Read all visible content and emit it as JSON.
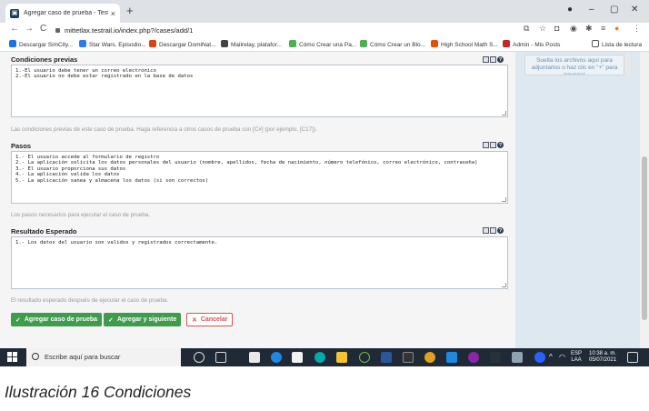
{
  "browser": {
    "tab_title": "Agregar caso de prueba - TestRail",
    "tab_close": "×",
    "new_tab": "+",
    "url": "mittetlax.testrail.io/index.php?/cases/add/1",
    "window_controls": {
      "minimize": "–",
      "maximize": "▢",
      "close": "✕"
    },
    "nav": {
      "back": "←",
      "forward": "→",
      "reload": "C"
    },
    "bookmarks": [
      {
        "label": "Descargar SimCity...",
        "color": "#1a73e8"
      },
      {
        "label": "Star Wars. Episodio...",
        "color": "#2b7de9"
      },
      {
        "label": "Descargar DomiNat...",
        "color": "#d84315"
      },
      {
        "label": "Mailrelay, platafor...",
        "color": "#444444"
      },
      {
        "label": "Cómo Crear una Pa...",
        "color": "#4caf50"
      },
      {
        "label": "Cómo Crear un Blo...",
        "color": "#4caf50"
      },
      {
        "label": "High School Math S...",
        "color": "#e65100"
      },
      {
        "label": "Admin - Mis Posts",
        "color": "#c62828"
      },
      {
        "label": "Lista de lectura",
        "color": "#555555"
      }
    ]
  },
  "attachments": {
    "dropzone_text": "Suelta los archivos aquí para adjuntarlos o haz clic en \"+\" para navegar"
  },
  "form": {
    "preconditions": {
      "label": "Condiciones previas",
      "value": "1.-El usuario debe tener un correo electrónico\n2.-El usuario no debe estar registrado en la base de datos",
      "help": "Las condiciones previas de este caso de prueba. Haga referencia a otros casos de prueba con [C#] (por ejemplo, [C17])."
    },
    "steps": {
      "label": "Pasos",
      "value": "1.- El usuario accede al formulario de registro\n2.- La aplicación solicita los datos personales del usuario (nombre, apellidos, fecha de nacimiento, número telefónico, correo electrónico, contraseña)\n3.- El usuario proporciona sus datos\n4.- La aplicación valida los datos\n5.- La aplicación sanea y almacena los datos (si son correctos)",
      "help": "Los pasos necesarios para ejecutar el caso de prueba."
    },
    "expected": {
      "label": "Resultado Esperado",
      "value": "1.- Los datos del usuario son validos y registrados correctamente.",
      "help": "El resultado esperado después de ejecutar el caso de prueba."
    },
    "buttons": {
      "add": "Agregar caso de prueba",
      "add_next": "Agregar y siguiente",
      "cancel": "Cancelar"
    }
  },
  "taskbar": {
    "search_placeholder": "Escribe aquí para buscar",
    "lang": "ESP",
    "lang2": "LAA",
    "time": "10:38 a. m.",
    "date": "05/07/2021"
  },
  "caption": "Ilustración 16 Condiciones"
}
